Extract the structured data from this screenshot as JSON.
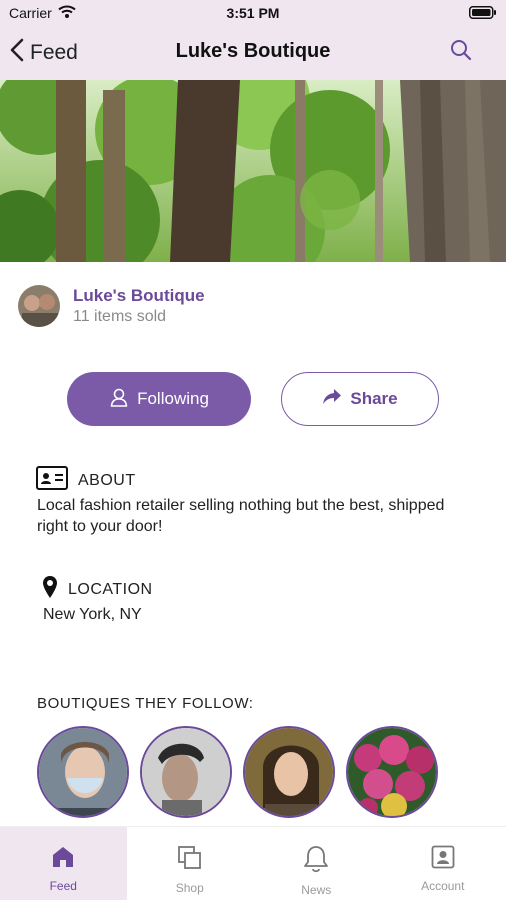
{
  "status_bar": {
    "carrier": "Carrier",
    "time": "3:51 PM"
  },
  "nav": {
    "back_label": "Feed",
    "title": "Luke's Boutique"
  },
  "shop": {
    "name": "Luke's Boutique",
    "items_sold": "11 items sold"
  },
  "actions": {
    "following_label": "Following",
    "share_label": "Share"
  },
  "about": {
    "heading": "ABOUT",
    "text": "Local fashion retailer selling nothing but the best, shipped right to your door!"
  },
  "location": {
    "heading": "LOCATION",
    "text": "New York, NY"
  },
  "boutiques_following": {
    "heading": "BOUTIQUES THEY FOLLOW:"
  },
  "tabs": [
    {
      "label": "Feed",
      "icon": "home-icon"
    },
    {
      "label": "Shop",
      "icon": "shop-icon"
    },
    {
      "label": "News",
      "icon": "bell-icon"
    },
    {
      "label": "Account",
      "icon": "account-icon"
    }
  ],
  "colors": {
    "accent": "#7b5ba8",
    "accent_text": "#6b4a9a",
    "nav_bg": "#efe6f0"
  }
}
